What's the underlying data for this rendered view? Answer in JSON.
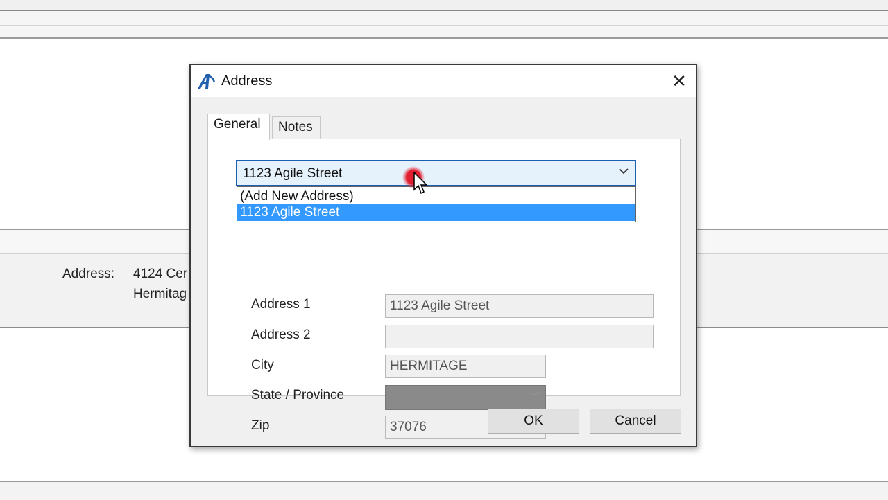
{
  "background": {
    "address_label": "Address:",
    "address_line1": "4124 Cer",
    "address_line2": "Hermitag"
  },
  "dialog": {
    "title": "Address",
    "tabs": [
      {
        "label": "General",
        "active": true
      },
      {
        "label": "Notes",
        "active": false
      }
    ],
    "combo": {
      "selected": "1123 Agile Street",
      "options": [
        "(Add New Address)",
        "1123 Agile Street"
      ],
      "highlighted_index": 1
    },
    "fields": {
      "address1": {
        "label": "Address 1",
        "value": "1123 Agile Street"
      },
      "address2": {
        "label": "Address 2",
        "value": ""
      },
      "city": {
        "label": "City",
        "value": "HERMITAGE"
      },
      "state": {
        "label": "State / Province",
        "value": ""
      },
      "zip": {
        "label": "Zip",
        "value": "37076"
      }
    },
    "buttons": {
      "ok": "OK",
      "cancel": "Cancel"
    }
  },
  "colors": {
    "accent": "#1a5fb4",
    "selection": "#3399ff",
    "click_marker": "#e02030"
  },
  "icons": {
    "app": "agile-a-logo-icon",
    "close": "close-icon",
    "dropdown": "chevron-down-icon",
    "cursor": "mouse-pointer-icon"
  }
}
